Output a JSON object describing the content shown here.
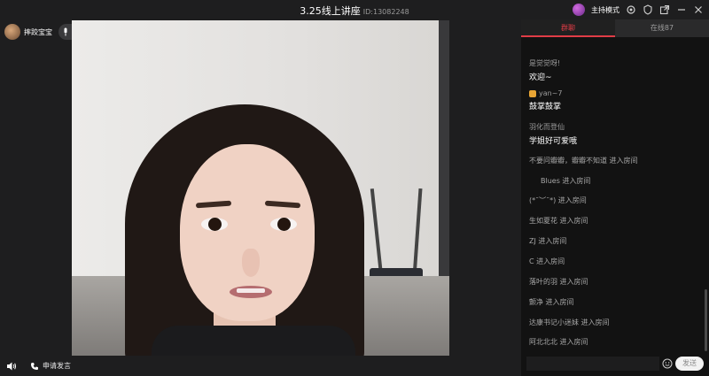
{
  "window": {
    "title": "3.25线上讲座",
    "room_id": "ID:13082248",
    "host_mode_label": "主持模式"
  },
  "host": {
    "name": "摔跤宝宝",
    "mic_label": "接麦"
  },
  "bottom_bar": {
    "apply_label": "申请发言"
  },
  "tabs": [
    {
      "label": "群聊",
      "active": true
    },
    {
      "label": "在线87",
      "active": false
    }
  ],
  "chat": {
    "messages": [
      {
        "user": "是觉觉呀!",
        "text": "欢迎~"
      },
      {
        "user": "yan~7",
        "text": "鼓掌鼓掌"
      },
      {
        "user": "羽化而登仙",
        "text": "学姐好可爱哦"
      }
    ],
    "events": [
      "不要问瓣瓣，瓣瓣不知道 进入房间",
      "Blues 进入房间",
      "(*¯︶¯*) 进入房间",
      "生如夏花 进入房间",
      "ZJ 进入房间",
      "C 进入房间",
      "落叶的羽 进入房间",
      "颤净 进入房间",
      "达康书记小迷妹 进入房间",
      "阿北北北 进入房间"
    ]
  },
  "composer": {
    "placeholder": "",
    "send_label": "发送"
  },
  "colors": {
    "accent": "#e03c46",
    "panel": "#121212",
    "background": "#1e1e1f"
  }
}
